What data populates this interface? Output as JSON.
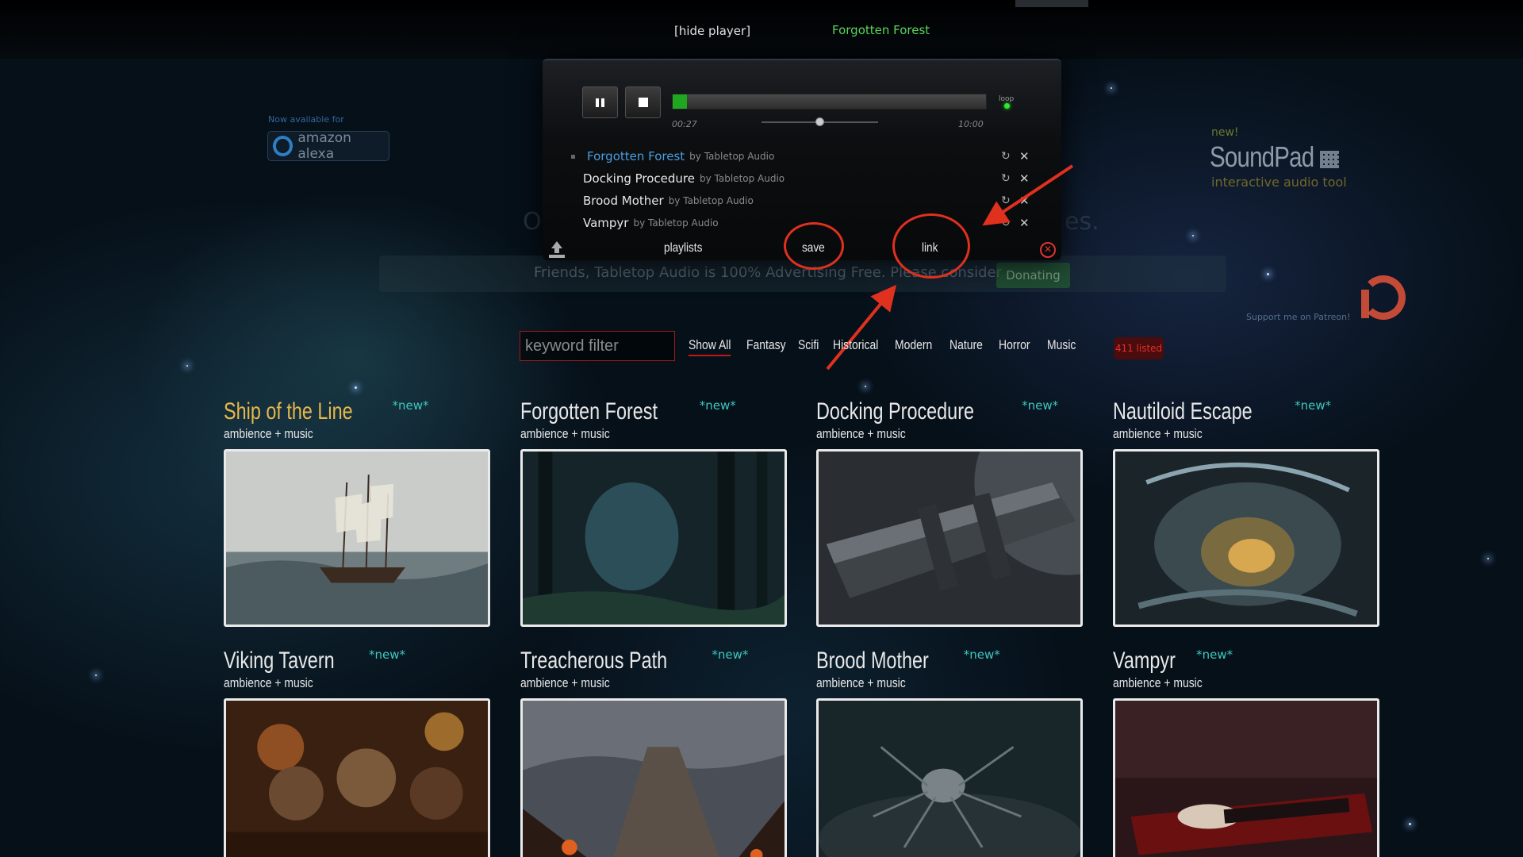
{
  "topbar": {
    "hide_player": "[hide player]",
    "now_playing": "Forgotten Forest"
  },
  "player": {
    "time_current": "00:27",
    "time_total": "10:00",
    "progress": 0.045,
    "volume": 0.5,
    "loop_label": "loop",
    "playlist": [
      {
        "title": "Forgotten Forest",
        "by": "by Tabletop Audio",
        "active": true
      },
      {
        "title": "Docking Procedure",
        "by": "by Tabletop Audio",
        "active": false
      },
      {
        "title": "Brood Mother",
        "by": "by Tabletop Audio",
        "active": false
      },
      {
        "title": "Vampyr",
        "by": "by Tabletop Audio",
        "active": false
      }
    ],
    "footer": {
      "playlists": "playlists",
      "save": "save",
      "link": "link"
    }
  },
  "alexa": {
    "available": "Now available for",
    "name": "amazon alexa"
  },
  "soundpad": {
    "new": "new!",
    "title": "SoundPad",
    "subtitle": "interactive audio tool"
  },
  "patreon": {
    "label": "Support me on Patreon!"
  },
  "background_text": {
    "left_fragment": "O",
    "right_fragment": "es.",
    "donate_text": "Friends, Tabletop Audio is 100% Advertising Free. Please consider",
    "donate_button": "Donating"
  },
  "filter": {
    "placeholder": "keyword filter",
    "categories": [
      "Show All",
      "Fantasy",
      "Scifi",
      "Historical",
      "Modern",
      "Nature",
      "Horror",
      "Music"
    ],
    "active": "Show All",
    "count": "411 listed"
  },
  "tiles": [
    {
      "title": "Ship of the Line",
      "new": "*new*",
      "sub": "ambience + music"
    },
    {
      "title": "Forgotten Forest",
      "new": "*new*",
      "sub": "ambience + music"
    },
    {
      "title": "Docking Procedure",
      "new": "*new*",
      "sub": "ambience + music"
    },
    {
      "title": "Nautiloid Escape",
      "new": "*new*",
      "sub": "ambience + music"
    },
    {
      "title": "Viking Tavern",
      "new": "*new*",
      "sub": "ambience + music"
    },
    {
      "title": "Treacherous Path",
      "new": "*new*",
      "sub": "ambience + music"
    },
    {
      "title": "Brood Mother",
      "new": "*new*",
      "sub": "ambience + music"
    },
    {
      "title": "Vampyr",
      "new": "*new*",
      "sub": "ambience + music"
    }
  ],
  "colors": {
    "accent_green": "#5ddc5d",
    "active_blue": "#4a9ee0",
    "annotation_red": "#e0301e",
    "new_teal": "#3cc8c0",
    "featured_gold": "#e8b84a"
  }
}
